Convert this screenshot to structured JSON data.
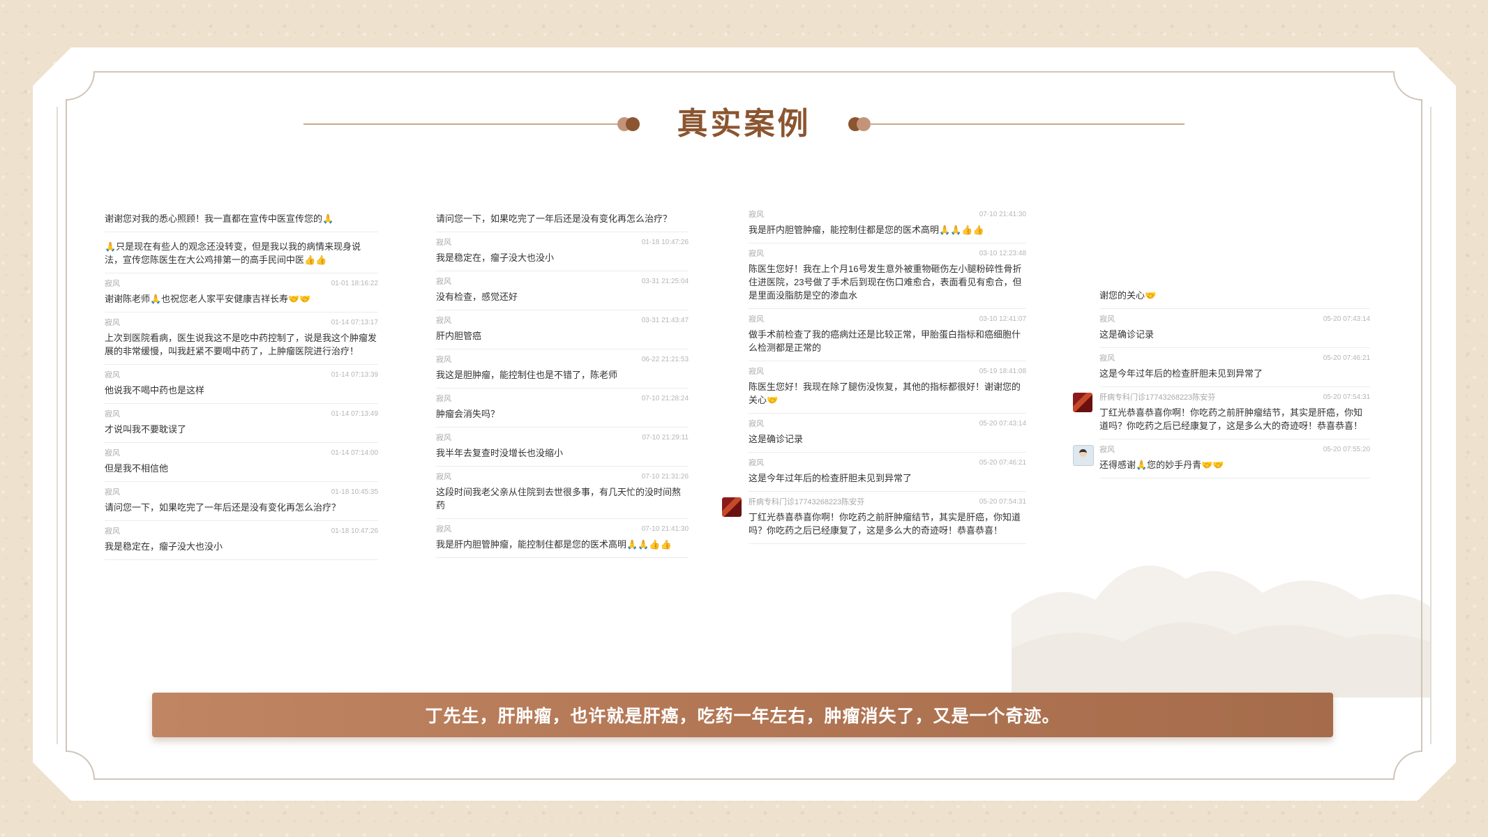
{
  "title": "真实案例",
  "colors": {
    "accent": "#8b5530",
    "banner": "#b27654",
    "paper": "#eee1cd"
  },
  "columns": [
    {
      "messages": [
        {
          "name": "",
          "time": "",
          "text": "谢谢您对我的悉心照顾！我一直都在宣传中医宣传您的🙏",
          "cut": true
        },
        {
          "name": "",
          "time": "",
          "text": "🙏只是现在有些人的观念还没转变，但是我以我的病情来现身说法，宣传您陈医生在大公鸡排第一的高手民间中医👍👍"
        },
        {
          "name": "寂风",
          "time": "01-01 18:16:22",
          "text": "谢谢陈老师🙏也祝您老人家平安健康吉祥长寿🤝🤝"
        },
        {
          "name": "寂风",
          "time": "01-14 07:13:17",
          "text": "上次到医院看病，医生说我这不是吃中药控制了，说是我这个肿瘤发展的非常缓慢，叫我赶紧不要喝中药了，上肿瘤医院进行治疗！"
        },
        {
          "name": "寂风",
          "time": "01-14 07:13:39",
          "text": "他说我不喝中药也是这样"
        },
        {
          "name": "寂风",
          "time": "01-14 07:13:49",
          "text": "才说叫我不要耽误了"
        },
        {
          "name": "寂风",
          "time": "01-14 07:14:00",
          "text": "但是我不相信他"
        },
        {
          "name": "寂风",
          "time": "01-18 10:45:35",
          "text": "请问您一下，如果吃完了一年后还是没有变化再怎么治疗？"
        },
        {
          "name": "寂风",
          "time": "01-18 10:47:26",
          "text": "我是稳定在，瘤子没大也没小"
        }
      ]
    },
    {
      "messages": [
        {
          "name": "",
          "time": "",
          "text": "请问您一下，如果吃完了一年后还是没有变化再怎么治疗？",
          "cut": true
        },
        {
          "name": "寂风",
          "time": "01-18 10:47:26",
          "text": "我是稳定在，瘤子没大也没小"
        },
        {
          "name": "寂风",
          "time": "03-31 21:25:04",
          "text": "没有检查，感觉还好"
        },
        {
          "name": "寂风",
          "time": "03-31 21:43:47",
          "text": "肝内胆管癌"
        },
        {
          "name": "寂风",
          "time": "06-22 21:21:53",
          "text": "我这是胆肿瘤，能控制住也是不错了，陈老师"
        },
        {
          "name": "寂风",
          "time": "07-10 21:28:24",
          "text": "肿瘤会消失吗？"
        },
        {
          "name": "寂风",
          "time": "07-10 21:29:11",
          "text": "我半年去复查时没增长也没缩小"
        },
        {
          "name": "寂风",
          "time": "07-10 21:31:26",
          "text": "这段时间我老父亲从住院到去世很多事，有几天忙的没时间熬药"
        },
        {
          "name": "寂风",
          "time": "07-10 21:41:30",
          "text": "我是肝内胆管肿瘤，能控制住都是您的医术高明🙏🙏👍👍"
        }
      ]
    },
    {
      "messages": [
        {
          "name": "寂风",
          "time": "07-10 21:41:30",
          "text": "我是肝内胆管肿瘤，能控制住都是您的医术高明🙏🙏👍👍",
          "cut": true
        },
        {
          "name": "寂风",
          "time": "03-10 12:23:48",
          "text": "陈医生您好！我在上个月16号发生意外被重物砸伤左小腿粉碎性骨折住进医院，23号做了手术后到现在伤口难愈合，表面看见有愈合，但是里面没脂肪是空的渗血水"
        },
        {
          "name": "寂风",
          "time": "03-10 12:41:07",
          "text": "做手术前检查了我的癌病灶还是比较正常，甲胎蛋白指标和癌细胞什么检测都是正常的"
        },
        {
          "name": "寂风",
          "time": "05-19 18:41:08",
          "text": "陈医生您好！我现在除了腿伤没恢复，其他的指标都很好！谢谢您的关心🤝"
        },
        {
          "name": "寂风",
          "time": "05-20 07:43:14",
          "text": "这是确诊记录"
        },
        {
          "name": "寂风",
          "time": "05-20 07:46:21",
          "text": "这是今年过年后的检查肝胆未见到异常了"
        },
        {
          "name": "肝病专科门诊17743268223陈安芬",
          "time": "05-20 07:54:31",
          "text": "丁红光恭喜恭喜你啊！你吃药之前肝肿瘤结节，其实是肝癌，你知道吗？你吃药之后已经康复了，这是多么大的奇迹呀！恭喜恭喜！",
          "avatar": "red"
        }
      ]
    },
    {
      "messages": [
        {
          "name": "",
          "time": "",
          "text": "谢您的关心🤝",
          "cut": true
        },
        {
          "name": "寂风",
          "time": "05-20 07:43:14",
          "text": "这是确诊记录"
        },
        {
          "name": "寂风",
          "time": "05-20 07:46:21",
          "text": "这是今年过年后的检查肝胆未见到异常了"
        },
        {
          "name": "肝病专科门诊17743268223陈安芬",
          "time": "05-20 07:54:31",
          "text": "丁红光恭喜恭喜你啊！你吃药之前肝肿瘤结节，其实是肝癌，你知道吗？你吃药之后已经康复了，这是多么大的奇迹呀！恭喜恭喜！",
          "avatar": "red"
        },
        {
          "name": "寂风",
          "time": "05-20 07:55:20",
          "text": "还得感谢🙏您的妙手丹青🤝🤝",
          "avatar": "face"
        }
      ]
    }
  ],
  "banner": {
    "text": "丁先生，肝肿瘤，也许就是肝癌，吃药一年左右，肿瘤消失了，又是一个奇迹。"
  }
}
